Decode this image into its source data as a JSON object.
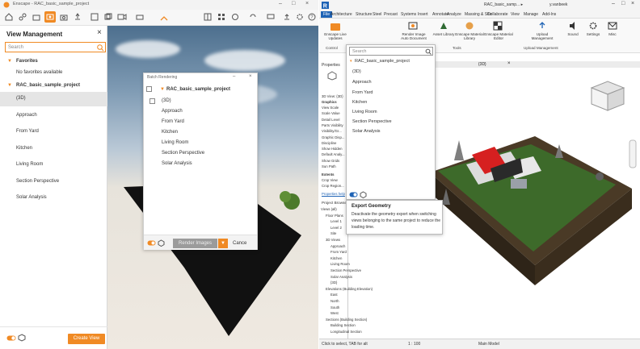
{
  "enscape": {
    "window_title": "Enscape - RAC_basic_sample_project",
    "view_management": {
      "title": "View Management",
      "search_placeholder": "Search",
      "favorites_label": "Favorites",
      "no_favorites_text": "No favorites available",
      "project_label": "RAC_basic_sample_project",
      "views": [
        "(3D)",
        "Approach",
        "From Yard",
        "Kitchen",
        "Living Room",
        "Section Perspective",
        "Solar Analysis"
      ],
      "create_view_label": "Create View"
    },
    "batch_rendering": {
      "title": "Batch Rendering",
      "project_label": "RAC_basic_sample_project",
      "views": [
        "(3D)",
        "Approach",
        "From Yard",
        "Kitchen",
        "Living Room",
        "Section Perspective",
        "Solar Analysis"
      ],
      "render_label": "Render Images",
      "cancel_label": "Cance"
    }
  },
  "revit": {
    "title": "RAC_basic_samp... ▸",
    "user": "y.vanbeek",
    "menu": [
      "File",
      "Architecture",
      "Structure",
      "Steel",
      "Precast",
      "Systems",
      "Insert",
      "Annotate",
      "Analyze",
      "Massing & Site",
      "Collaborate",
      "View",
      "Manage",
      "Add-Ins"
    ],
    "ribbon": {
      "buttons": [
        "Enscape Live Updates",
        "Render Image Auto Document",
        "Asset Library",
        "Enscape Material Library",
        "Enscape Material Editor",
        "Upload Management",
        "Sound",
        "Settings",
        "Misc"
      ],
      "sections": [
        "Control",
        "Tools",
        "Upload Management"
      ]
    },
    "properties": {
      "title": "Properties",
      "type": "3D View: {3D}",
      "section_graphics": "Graphics",
      "rows": [
        "View Scale",
        "Scale Value",
        "Detail Level",
        "Parts Visibility",
        "Visibility/Gr...",
        "Graphic Disp...",
        "Discipline",
        "Show Hidden",
        "Default Analy...",
        "Show Grids",
        "Sun Path"
      ],
      "section_extents": "Extents",
      "extents_rows": [
        "Crop View",
        "Crop Region..."
      ],
      "help_link": "Properties help"
    },
    "browser": {
      "title": "Project Browser",
      "items": [
        "Views (all)",
        "Floor Plans",
        "Level 1",
        "Level 2",
        "Site",
        "3D Views",
        "Approach",
        "From Yard",
        "Kitchen",
        "Living Room",
        "Section Perspective",
        "Solar Analysis",
        "{3D}",
        "Elevations (Building Elevation)",
        "East",
        "North",
        "South",
        "West",
        "Sections (Building Section)",
        "Building Section",
        "Longitudinal Section"
      ]
    },
    "tab_label": "{3D}",
    "scale": "1 : 100",
    "status_text": "Click to select, TAB for alt",
    "model_label": "Main Model",
    "dropdown": {
      "search_placeholder": "Search",
      "project_label": "RAC_basic_sample_project",
      "views": [
        "(3D)",
        "Approach",
        "From Yard",
        "Kitchen",
        "Living Room",
        "Section Perspective",
        "Solar Analysis"
      ]
    },
    "tooltip": {
      "title": "Export Geometry",
      "body": "Deactivate the geometry export when switching views belonging to the same project to reduce the loading time."
    }
  },
  "colors": {
    "accent": "#f08a24",
    "revit_blue": "#1f63b5"
  }
}
